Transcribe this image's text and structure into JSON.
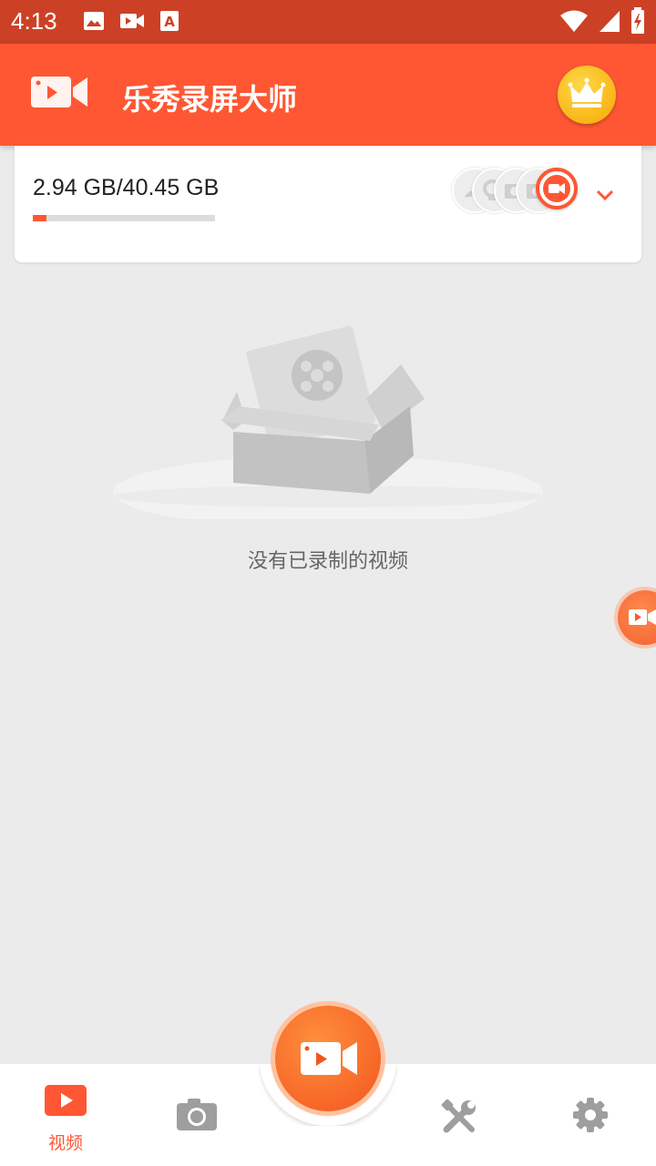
{
  "status_bar": {
    "time": "4:13",
    "left_icons": [
      "image-icon",
      "video-icon",
      "text-a-icon"
    ],
    "right_icons": [
      "wifi-icon",
      "signal-icon",
      "battery-icon"
    ]
  },
  "app_bar": {
    "title": "乐秀录屏大师",
    "logo_icon": "screen-recorder-logo-icon",
    "vip_icon": "crown-icon"
  },
  "storage": {
    "text": "2.94 GB/40.45 GB",
    "used_fraction": 0.073,
    "mode_icons": [
      "shape-icon",
      "webcam-icon",
      "camera-icon",
      "video-camera-icon"
    ],
    "expand_icon": "chevron-down-icon"
  },
  "empty_state": {
    "message": "没有已录制的视频",
    "icon": "empty-box-film-icon"
  },
  "bottom_nav": {
    "items": [
      {
        "label": "视频",
        "icon": "video-play-icon",
        "active": true
      },
      {
        "label": "",
        "icon": "camera-icon",
        "active": false
      },
      {
        "label": "",
        "icon": "tools-icon",
        "active": false
      },
      {
        "label": "",
        "icon": "gear-icon",
        "active": false
      }
    ],
    "record_icon": "record-camera-icon"
  },
  "colors": {
    "primary": "#ff5733",
    "status_bar": "#cc4125",
    "background": "#ebebeb",
    "crown": "#f6a800",
    "inactive_icon": "#9e9e9e"
  }
}
